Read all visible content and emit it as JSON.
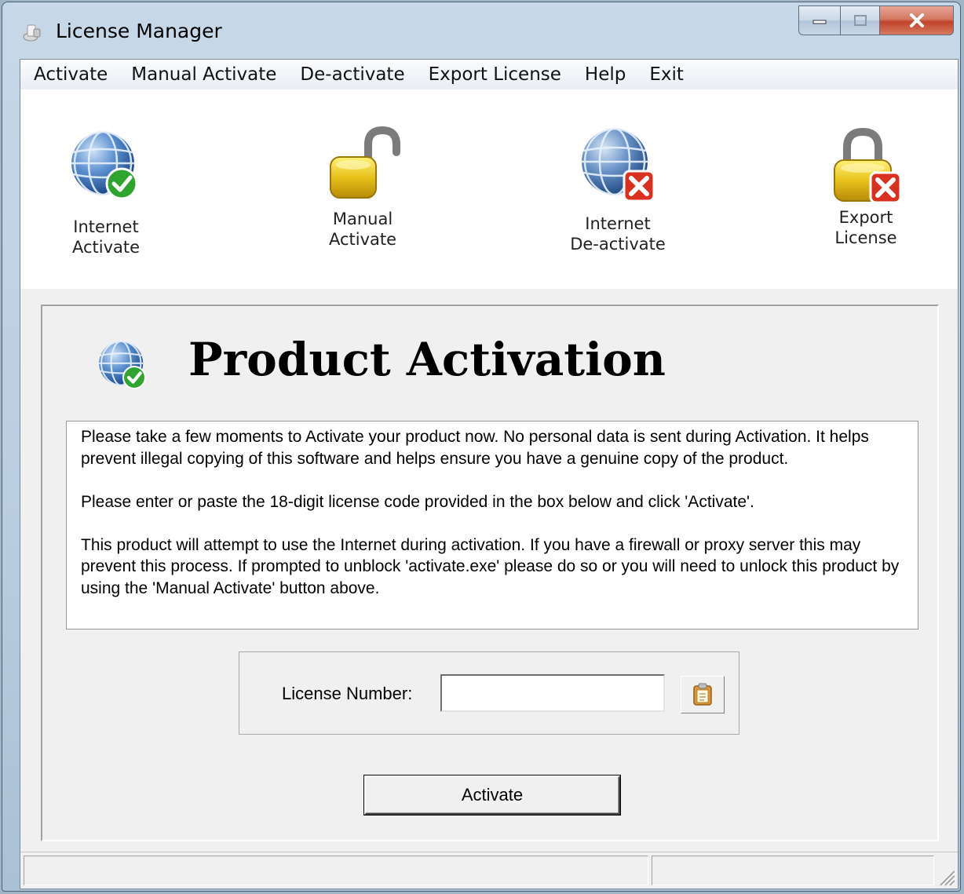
{
  "window": {
    "title": "License Manager"
  },
  "menu": [
    {
      "label": "Activate"
    },
    {
      "label": "Manual Activate"
    },
    {
      "label": "De-activate"
    },
    {
      "label": "Export License"
    },
    {
      "label": "Help"
    },
    {
      "label": "Exit"
    }
  ],
  "toolbar": {
    "internet_activate": {
      "label": "Internet\nActivate",
      "icon": "globe-check-icon"
    },
    "manual_activate": {
      "label": "Manual\nActivate",
      "icon": "padlock-open-icon"
    },
    "internet_deactivate": {
      "label": "Internet\nDe-activate",
      "icon": "globe-x-icon"
    },
    "export_license": {
      "label": "Export\nLicense",
      "icon": "padlock-x-icon"
    }
  },
  "panel": {
    "title": "Product Activation",
    "paragraphs": [
      "Please take a few moments to Activate your product now.  No personal data is sent during Activation.  It helps prevent illegal copying of this software and helps ensure you have a genuine copy of the product.",
      "Please enter or paste the 18-digit license code provided in the box below and click 'Activate'.",
      "This product will attempt to use the Internet during activation.  If you have a firewall or proxy server this may prevent this process.  If prompted to unblock 'activate.exe' please do so or you will need to unlock this product by using the 'Manual Activate' button above."
    ],
    "license_label": "License Number:",
    "license_value": "",
    "activate_button": "Activate"
  },
  "colors": {
    "check_green": "#2fa52f",
    "error_red": "#d93020",
    "lock_gold": "#e8c21a",
    "globe_blue": "#2f62a8"
  }
}
